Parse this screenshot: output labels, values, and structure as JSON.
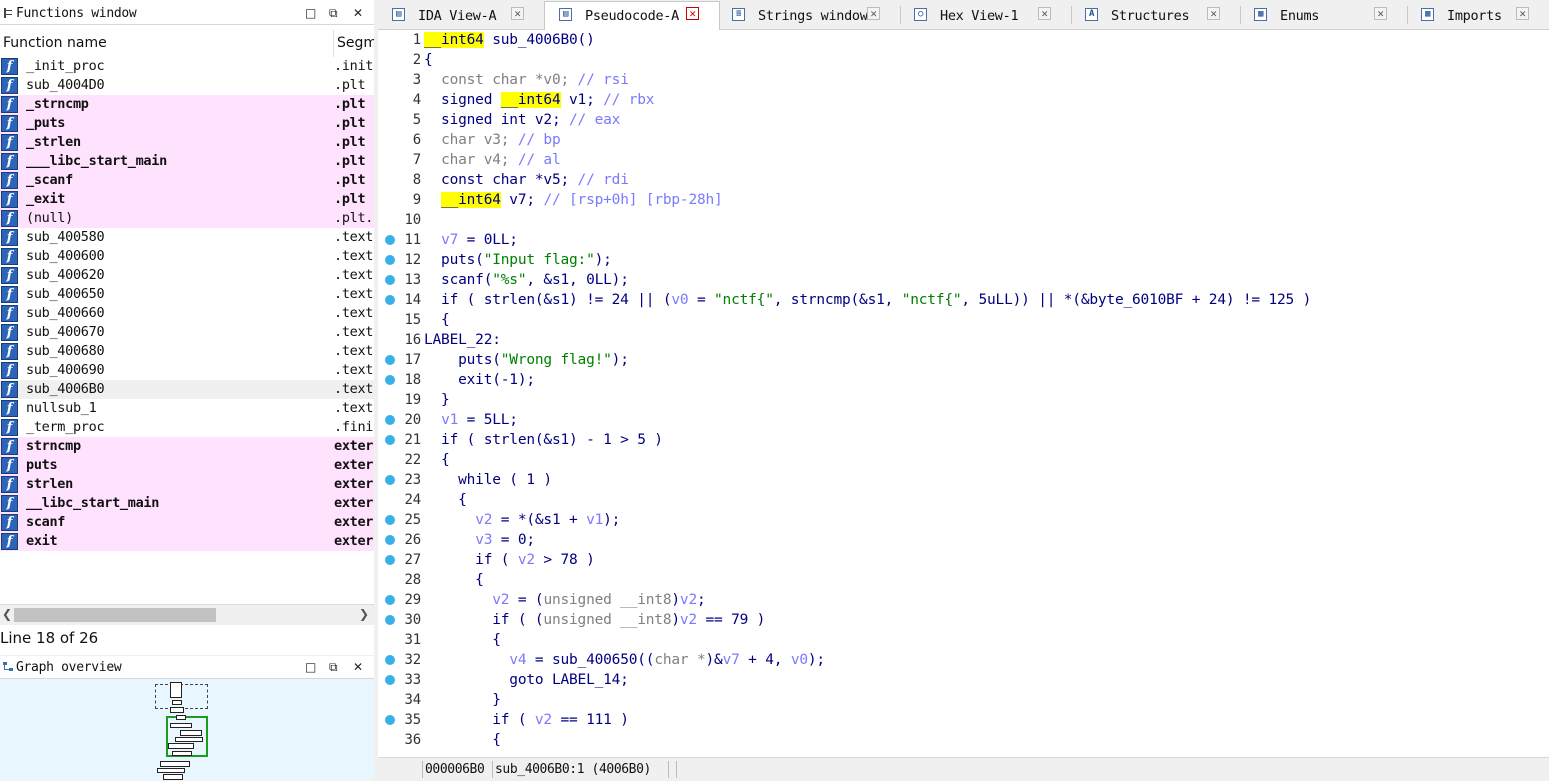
{
  "functions_window": {
    "title": "Functions window",
    "columns": {
      "name": "Function name",
      "segment": "Segm"
    },
    "rows": [
      {
        "name": "_init_proc",
        "segment": ".init",
        "pink": false
      },
      {
        "name": "sub_4004D0",
        "segment": ".plt",
        "pink": false
      },
      {
        "name": "_strncmp",
        "segment": ".plt",
        "pink": true
      },
      {
        "name": "_puts",
        "segment": ".plt",
        "pink": true
      },
      {
        "name": "_strlen",
        "segment": ".plt",
        "pink": true
      },
      {
        "name": "___libc_start_main",
        "segment": ".plt",
        "pink": true
      },
      {
        "name": "_scanf",
        "segment": ".plt",
        "pink": true
      },
      {
        "name": "_exit",
        "segment": ".plt",
        "pink": true
      },
      {
        "name": "(null)",
        "segment": ".plt.",
        "pink": true
      },
      {
        "name": "sub_400580",
        "segment": ".text",
        "pink": false
      },
      {
        "name": "sub_400600",
        "segment": ".text",
        "pink": false
      },
      {
        "name": "sub_400620",
        "segment": ".text",
        "pink": false
      },
      {
        "name": "sub_400650",
        "segment": ".text",
        "pink": false
      },
      {
        "name": "sub_400660",
        "segment": ".text",
        "pink": false
      },
      {
        "name": "sub_400670",
        "segment": ".text",
        "pink": false
      },
      {
        "name": "sub_400680",
        "segment": ".text",
        "pink": false
      },
      {
        "name": "sub_400690",
        "segment": ".text",
        "pink": false
      },
      {
        "name": "sub_4006B0",
        "segment": ".text",
        "pink": false,
        "selected": true
      },
      {
        "name": "nullsub_1",
        "segment": ".text",
        "pink": false
      },
      {
        "name": "_term_proc",
        "segment": ".fini",
        "pink": false
      },
      {
        "name": "strncmp",
        "segment": "exter",
        "pink": true
      },
      {
        "name": "puts",
        "segment": "exter",
        "pink": true
      },
      {
        "name": "strlen",
        "segment": "exter",
        "pink": true
      },
      {
        "name": "__libc_start_main",
        "segment": "exter",
        "pink": true
      },
      {
        "name": "scanf",
        "segment": "exter",
        "pink": true
      },
      {
        "name": "exit",
        "segment": "exter",
        "pink": true
      }
    ],
    "line_info": "Line 18 of 26"
  },
  "graph_overview": {
    "title": "Graph overview"
  },
  "tabs": [
    {
      "label": "IDA View-A",
      "icon": "ida-view-icon",
      "active": false
    },
    {
      "label": "Pseudocode-A",
      "icon": "pseudocode-icon",
      "active": true
    },
    {
      "label": "Strings window",
      "icon": "strings-icon",
      "active": false
    },
    {
      "label": "Hex View-1",
      "icon": "hex-view-icon",
      "active": false
    },
    {
      "label": "Structures",
      "icon": "structures-icon",
      "active": false
    },
    {
      "label": "Enums",
      "icon": "enums-icon",
      "active": false
    },
    {
      "label": "Imports",
      "icon": "imports-icon",
      "active": false
    }
  ],
  "code_lines": [
    {
      "n": "1",
      "dot": false,
      "html": "<span class=\"hl\">__int64</span> sub_4006B0()"
    },
    {
      "n": "2",
      "dot": false,
      "html": "{"
    },
    {
      "n": "3",
      "dot": false,
      "html": "  <span class=\"gr\">const char *v0;</span> <span class=\"cm\">// rsi</span>"
    },
    {
      "n": "4",
      "dot": false,
      "html": "  signed <span class=\"hl\">__int64</span> v1; <span class=\"cm\">// rbx</span>"
    },
    {
      "n": "5",
      "dot": false,
      "html": "  signed int v2; <span class=\"cm\">// eax</span>"
    },
    {
      "n": "6",
      "dot": false,
      "html": "  <span class=\"gr\">char v3;</span> <span class=\"cm\">// bp</span>"
    },
    {
      "n": "7",
      "dot": false,
      "html": "  <span class=\"gr\">char v4;</span> <span class=\"cm\">// al</span>"
    },
    {
      "n": "8",
      "dot": false,
      "html": "  const char *v5; <span class=\"cm\">// rdi</span>"
    },
    {
      "n": "9",
      "dot": false,
      "html": "  <span class=\"hl\">__int64</span> v7; <span class=\"cm\">// [rsp+0h] [rbp-28h]</span>"
    },
    {
      "n": "10",
      "dot": false,
      "html": ""
    },
    {
      "n": "11",
      "dot": true,
      "html": "  <span class=\"vr\">v7</span> = 0LL;"
    },
    {
      "n": "12",
      "dot": true,
      "html": "  puts(<span class=\"st\">\"Input flag:\"</span>);"
    },
    {
      "n": "13",
      "dot": true,
      "html": "  scanf(<span class=\"st\">\"%s\"</span>, &amp;s1, 0LL);"
    },
    {
      "n": "14",
      "dot": true,
      "html": "  if ( strlen(&amp;s1) != 24 || (<span class=\"vr\">v0</span> = <span class=\"st\">\"nctf{\"</span>, strncmp(&amp;s1, <span class=\"st\">\"nctf{\"</span>, 5uLL)) || *(&amp;byte_6010BF + 24) != 125 )"
    },
    {
      "n": "15",
      "dot": false,
      "html": "  {"
    },
    {
      "n": "16",
      "dot": false,
      "html": "LABEL_22:"
    },
    {
      "n": "17",
      "dot": true,
      "html": "    puts(<span class=\"st\">\"Wrong flag!\"</span>);"
    },
    {
      "n": "18",
      "dot": true,
      "html": "    exit(-1);"
    },
    {
      "n": "19",
      "dot": false,
      "html": "  }"
    },
    {
      "n": "20",
      "dot": true,
      "html": "  <span class=\"vr\">v1</span> = 5LL;"
    },
    {
      "n": "21",
      "dot": true,
      "html": "  if ( strlen(&amp;s1) - 1 &gt; 5 )"
    },
    {
      "n": "22",
      "dot": false,
      "html": "  {"
    },
    {
      "n": "23",
      "dot": true,
      "html": "    while ( 1 )"
    },
    {
      "n": "24",
      "dot": false,
      "html": "    {"
    },
    {
      "n": "25",
      "dot": true,
      "html": "      <span class=\"vr\">v2</span> = *(&amp;s1 + <span class=\"vr\">v1</span>);"
    },
    {
      "n": "26",
      "dot": true,
      "html": "      <span class=\"vr\">v3</span> = 0;"
    },
    {
      "n": "27",
      "dot": true,
      "html": "      if ( <span class=\"vr\">v2</span> &gt; 78 )"
    },
    {
      "n": "28",
      "dot": false,
      "html": "      {"
    },
    {
      "n": "29",
      "dot": true,
      "html": "        <span class=\"vr\">v2</span> = (<span class=\"gr\">unsigned __int8</span>)<span class=\"vr\">v2</span>;"
    },
    {
      "n": "30",
      "dot": true,
      "html": "        if ( (<span class=\"gr\">unsigned __int8</span>)<span class=\"vr\">v2</span> == 79 )"
    },
    {
      "n": "31",
      "dot": false,
      "html": "        {"
    },
    {
      "n": "32",
      "dot": true,
      "html": "          <span class=\"vr\">v4</span> = sub_400650((<span class=\"gr\">char *</span>)&amp;<span class=\"vr\">v7</span> + 4, <span class=\"vr\">v0</span>);"
    },
    {
      "n": "33",
      "dot": true,
      "html": "          goto LABEL_14;"
    },
    {
      "n": "34",
      "dot": false,
      "html": "        }"
    },
    {
      "n": "35",
      "dot": true,
      "html": "        if ( <span class=\"vr\">v2</span> == 111 )"
    },
    {
      "n": "36",
      "dot": false,
      "html": "        {"
    }
  ],
  "status_bar": {
    "address": "000006B0",
    "location": "sub_4006B0:1 (4006B0)"
  },
  "colors": {
    "pink_row": "#ffe2fd",
    "highlight": "#ffff00",
    "string": "#008000",
    "keyword": "#000080",
    "variable": "#7a7aff",
    "breakpoint_dot": "#38b0e8"
  }
}
